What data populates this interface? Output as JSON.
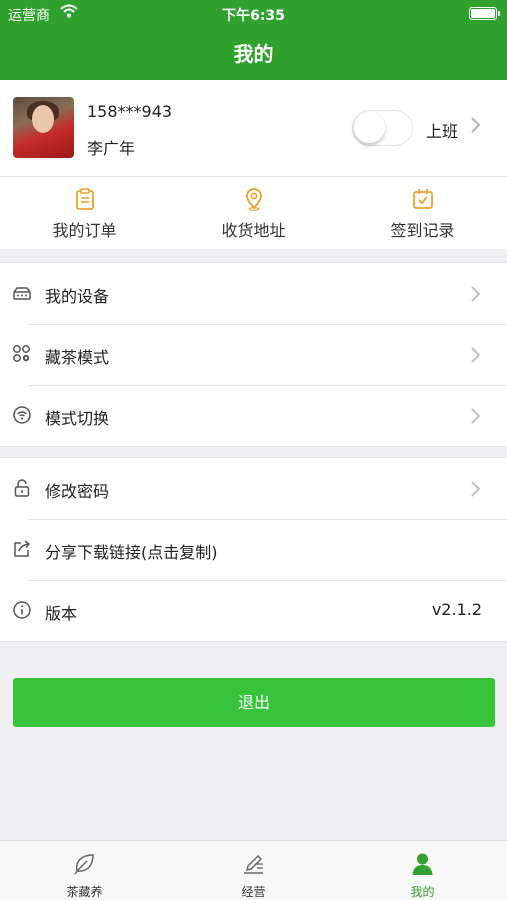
{
  "status_bar": {
    "carrier": "运营商",
    "time": "下午6:35"
  },
  "nav": {
    "title": "我的"
  },
  "profile": {
    "phone": "158***943",
    "name": "李广年",
    "work_status_label": "上班",
    "work_toggle_on": false
  },
  "quick_actions": [
    {
      "label": "我的订单",
      "icon": "order-clipboard-icon"
    },
    {
      "label": "收货地址",
      "icon": "location-pin-icon"
    },
    {
      "label": "签到记录",
      "icon": "checkin-calendar-icon"
    }
  ],
  "menu_group_1": [
    {
      "label": "我的设备",
      "icon": "device-icon"
    },
    {
      "label": "藏茶模式",
      "icon": "mode-grid-icon"
    },
    {
      "label": "模式切换",
      "icon": "wifi-switch-icon"
    }
  ],
  "menu_group_2": [
    {
      "label": "修改密码",
      "icon": "lock-icon"
    },
    {
      "label": "分享下载链接(点击复制)",
      "icon": "share-icon"
    },
    {
      "label": "版本",
      "icon": "info-icon",
      "value": "v2.1.2"
    }
  ],
  "logout_label": "退出",
  "tabs": [
    {
      "label": "茶藏养",
      "icon": "leaf-icon",
      "active": false
    },
    {
      "label": "经营",
      "icon": "edit-icon",
      "active": false
    },
    {
      "label": "我的",
      "icon": "person-icon",
      "active": true
    }
  ],
  "colors": {
    "brand_green": "#2fa12c",
    "button_green": "#37c33a",
    "icon_orange": "#f0a02a"
  }
}
